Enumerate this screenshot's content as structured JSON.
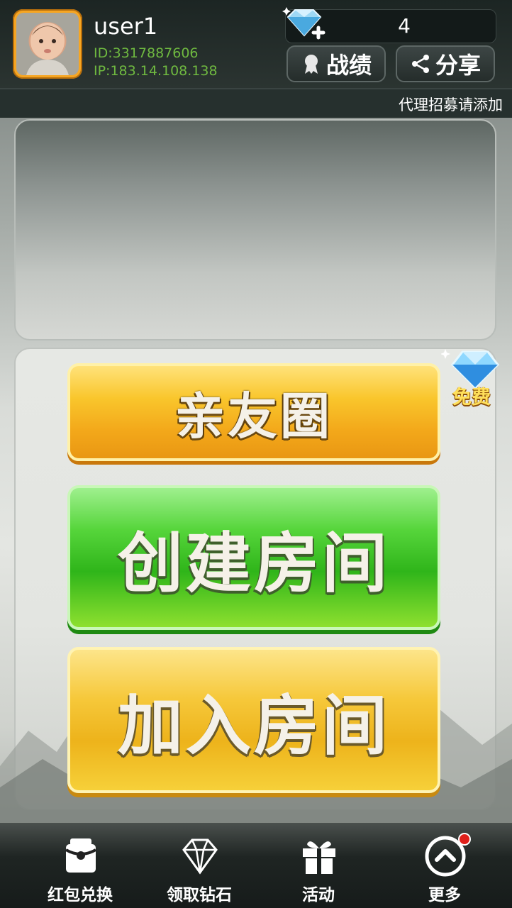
{
  "header": {
    "username": "user1",
    "user_id": "ID:3317887606",
    "user_ip": "IP:183.14.108.138",
    "diamond_count": "4",
    "record_label": "战绩",
    "share_label": "分享"
  },
  "notice": {
    "text": "代理招募请添加"
  },
  "main": {
    "friend_circle_label": "亲友圈",
    "create_room_label": "创建房间",
    "join_room_label": "加入房间",
    "free_badge_label": "免费"
  },
  "bottom_nav": {
    "items": [
      {
        "label": "红包兑换",
        "icon": "red-packet-icon"
      },
      {
        "label": "领取钻石",
        "icon": "diamond-icon"
      },
      {
        "label": "活动",
        "icon": "gift-icon"
      },
      {
        "label": "更多",
        "icon": "chevron-up-circle-icon"
      }
    ]
  },
  "colors": {
    "id_text": "#6fb940",
    "avatar_border": "#f6a623",
    "gold_button": "#f3a81a",
    "green_button": "#2fb51a",
    "notification_dot": "#e0201b"
  }
}
